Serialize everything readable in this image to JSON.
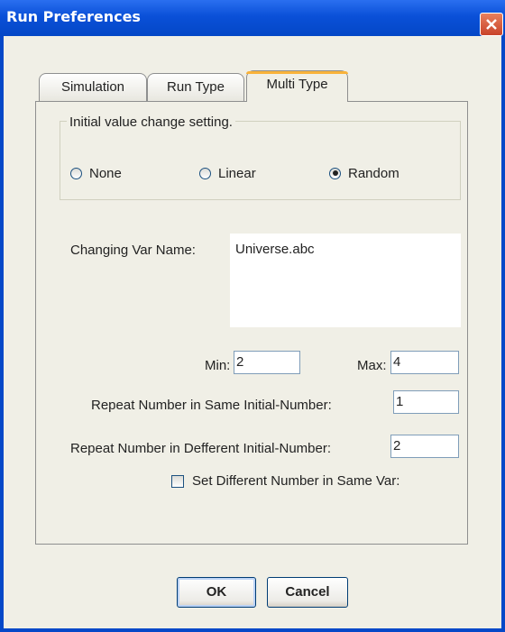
{
  "window": {
    "title": "Run Preferences"
  },
  "tabs": [
    {
      "label": "Simulation",
      "active": false
    },
    {
      "label": "Run Type",
      "active": false
    },
    {
      "label": "Multi Type",
      "active": true
    }
  ],
  "initial_value": {
    "group_title": "Initial value change setting.",
    "options": [
      {
        "label": "None",
        "selected": false
      },
      {
        "label": "Linear",
        "selected": false
      },
      {
        "label": "Random",
        "selected": true
      }
    ]
  },
  "changing_var": {
    "label": "Changing Var Name:",
    "value": "Universe.abc"
  },
  "min": {
    "label": "Min:",
    "value": "2"
  },
  "max": {
    "label": "Max:",
    "value": "4"
  },
  "repeat_same": {
    "label": "Repeat Number in Same Initial-Number:",
    "value": "1"
  },
  "repeat_diff": {
    "label": "Repeat Number in Defferent Initial-Number:",
    "value": "2"
  },
  "set_different": {
    "label": "Set Different Number in Same Var:",
    "checked": false
  },
  "buttons": {
    "ok": "OK",
    "cancel": "Cancel"
  },
  "colors": {
    "titlebar": "#0a50d8",
    "active_tab_accent": "#f8b23a",
    "close_button": "#c8432a"
  }
}
